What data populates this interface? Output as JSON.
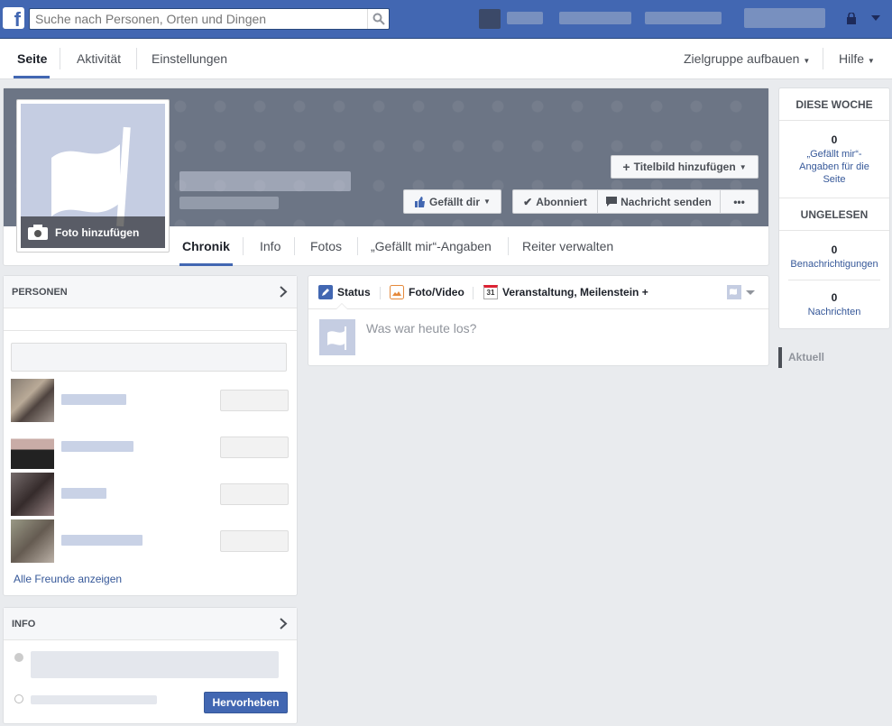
{
  "topbar": {
    "logo": "f",
    "search_placeholder": "Suche nach Personen, Orten und Dingen"
  },
  "nav": {
    "tabs": [
      "Seite",
      "Aktivität",
      "Einstellungen"
    ],
    "right": [
      "Zielgruppe aufbauen",
      "Hilfe"
    ]
  },
  "cover": {
    "add_cover_label": "Titelbild hinzufügen",
    "photo_label": "Foto hinzufügen",
    "like_label": "Gefällt dir",
    "subscribed_label": "Abonniert",
    "message_label": "Nachricht senden",
    "more_label": "•••",
    "tabs": [
      "Chronik",
      "Info",
      "Fotos",
      "„Gefällt mir“-Angaben",
      "Reiter verwalten"
    ]
  },
  "people": {
    "title": "PERSONEN",
    "see_all": "Alle Freunde anzeigen"
  },
  "info": {
    "title": "INFO",
    "highlight_label": "Hervorheben"
  },
  "composer": {
    "tabs": [
      "Status",
      "Foto/Video",
      "Veranstaltung, Meilenstein +"
    ],
    "calendar_day": "31",
    "placeholder": "Was war heute los?"
  },
  "right": {
    "week_title": "DIESE WOCHE",
    "likes_count": "0",
    "likes_label": "„Gefällt mir“-Angaben für die Seite",
    "unread_title": "UNGELESEN",
    "notifications_count": "0",
    "notifications_label": "Benachrichtigungen",
    "messages_count": "0",
    "messages_label": "Nachrichten",
    "current_label": "Aktuell"
  },
  "colors": {
    "brand": "#4267b2",
    "link": "#365899",
    "primary_button": "#4267b2"
  }
}
